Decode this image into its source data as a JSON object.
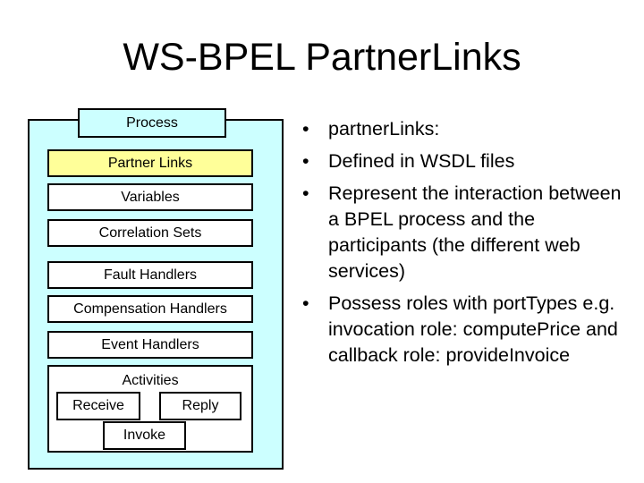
{
  "title": "WS-BPEL PartnerLinks",
  "diagram": {
    "process": "Process",
    "partner_links": "Partner Links",
    "variables": "Variables",
    "correlation_sets": "Correlation Sets",
    "fault_handlers": "Fault Handlers",
    "compensation_handlers": "Compensation Handlers",
    "event_handlers": "Event Handlers",
    "activities": "Activities",
    "receive": "Receive",
    "reply": "Reply",
    "invoke": "Invoke",
    "colors": {
      "process_fill": "#ccffff",
      "highlight_fill": "#ffff99",
      "box_fill": "#ffffff",
      "border": "#000000"
    }
  },
  "bullets": [
    {
      "text": "partnerLinks:"
    },
    {
      "text": "Defined in WSDL files"
    },
    {
      "text": "Represent the interaction between a BPEL process and the participants (the different web services)"
    },
    {
      "text": "Possess roles with portTypes e.g. invocation role: computePrice and callback role: provideInvoice"
    }
  ],
  "bullet_glyph": "•"
}
